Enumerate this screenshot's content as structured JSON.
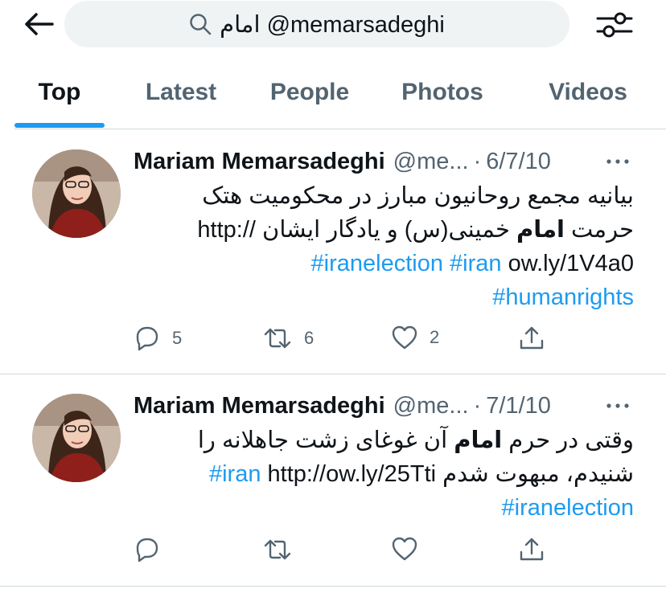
{
  "search": {
    "query": "امام @memarsadeghi"
  },
  "tabs": [
    {
      "label": "Top",
      "active": true
    },
    {
      "label": "Latest"
    },
    {
      "label": "People"
    },
    {
      "label": "Photos"
    },
    {
      "label": "Videos"
    }
  ],
  "tweets": [
    {
      "name": "Mariam Memarsadeghi",
      "handle": "@me...",
      "dot": "·",
      "date": "6/7/10",
      "line1": "بیانیه مجمع روحانیون مبارز در محکومیت هتک",
      "line2_pre": "حرمت ",
      "line2_bold": "امام",
      "line2_post": " خمینی(س) و یادگار ایشان //:http",
      "line3_url": "ow.ly/1V4a0",
      "tag_iranelection": "#iranelection",
      "tag_iran": "#iran",
      "tag_humanrights": "#humanrights",
      "replies": "5",
      "retweets": "6",
      "likes": "2"
    },
    {
      "name": "Mariam Memarsadeghi",
      "handle": "@me...",
      "dot": "·",
      "date": "7/1/10",
      "line1_pre": "وقتی در حرم ",
      "line1_bold": "امام",
      "line1_post": " آن غوغای زشت جاهلانه را",
      "line2_text": "شنیدم، مبهوت شدم http://ow.ly/25Tti",
      "tag_iran": "#iran",
      "tag_iranelection": "#iranelection"
    }
  ],
  "colors": {
    "accent": "#1d9bf0",
    "text": "#0f1419",
    "muted": "#536471",
    "border": "#cfd9de"
  },
  "icons": [
    "back-arrow-icon",
    "search-icon",
    "filter-sliders-icon",
    "more-icon",
    "reply-icon",
    "retweet-icon",
    "like-icon",
    "share-icon"
  ]
}
